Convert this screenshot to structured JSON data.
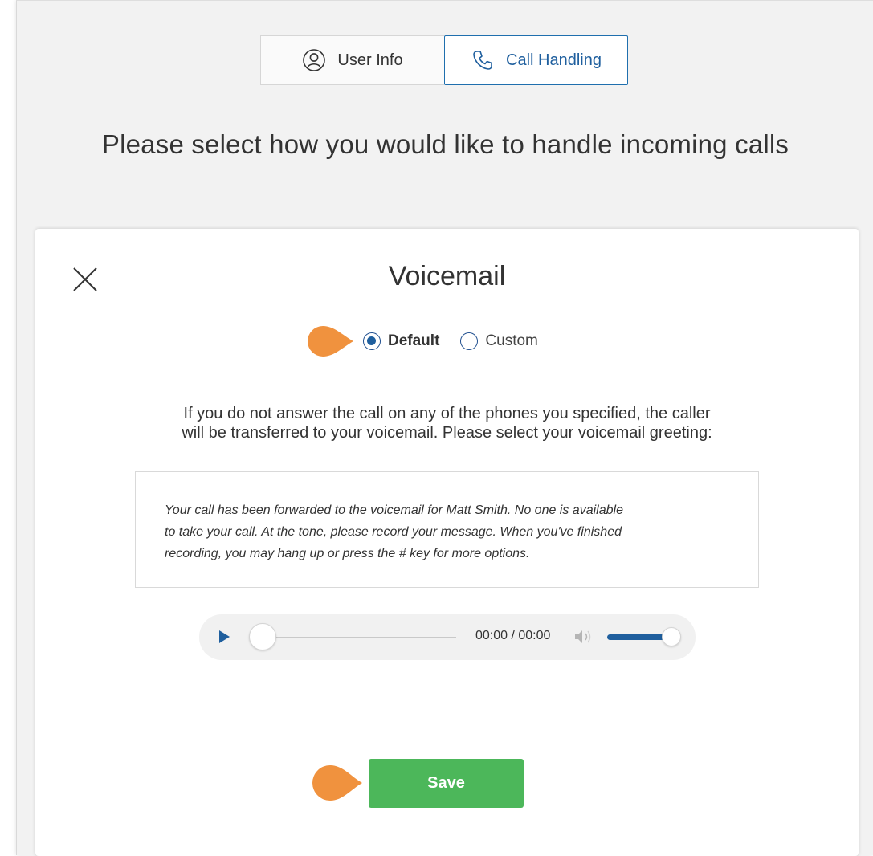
{
  "tabs": {
    "user_info": {
      "label": "User Info",
      "icon": "user-icon"
    },
    "call_handling": {
      "label": "Call Handling",
      "icon": "phone-icon"
    }
  },
  "heading": "Please select how you would like to handle incoming calls",
  "dialog": {
    "title": "Voicemail",
    "close_icon": "close-icon",
    "options": [
      {
        "label": "Default",
        "selected": true
      },
      {
        "label": "Custom",
        "selected": false
      }
    ],
    "instructions": [
      "If you do not answer the call on any of the phones you specified, the caller",
      "will be transferred to your voicemail. Please select your voicemail greeting:"
    ],
    "greeting_lines": [
      "Your call has been forwarded to the voicemail for Matt Smith. No one is available",
      "to take your call. At the tone, please record your message. When you've finished",
      "recording, you may hang up or press the # key for more options."
    ],
    "player": {
      "time": "00:00 / 00:00",
      "progress": 0,
      "volume": 1.0
    },
    "save_label": "Save"
  },
  "colors": {
    "accent_blue": "#1f5f9e",
    "save_green": "#4cb75a",
    "marker_orange": "#f0923e"
  }
}
